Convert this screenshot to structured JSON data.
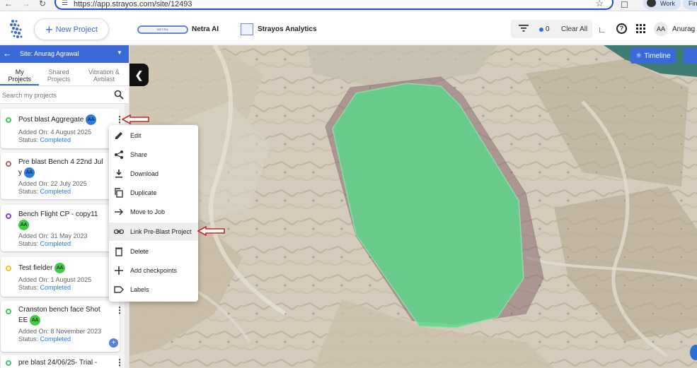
{
  "browser": {
    "url": "https://app.strayos.com/site/12493",
    "profile_label": "Work",
    "extra_tab": "Fini"
  },
  "header": {
    "new_project_label": "New Project",
    "netra_badge": "NETRA",
    "netra_label": "Netra AI",
    "analytics_label": "Strayos Analytics",
    "filter_count": "0",
    "clear_all_label": "Clear All",
    "avatar_initials": "AA",
    "user_name": "Anurag A"
  },
  "sidebar": {
    "site_label": "Site: Anurag Agrawal",
    "tabs": [
      {
        "line1": "My",
        "line2": "Projects"
      },
      {
        "line1": "Shared",
        "line2": "Projects"
      },
      {
        "line1": "Vibration &",
        "line2": "Airblast"
      }
    ],
    "search_placeholder": "Search my projects",
    "projects": [
      {
        "title": "Post blast Aggregate",
        "avatar": "AA",
        "avatar_color": "#2b7ee0",
        "dot_color": "#3cc96a",
        "added": "Added On: 4 August 2025",
        "status_prefix": "Status: ",
        "status": "Completed"
      },
      {
        "title": "Pre blast Bench 4 22nd Jul",
        "title2": "y",
        "avatar": "AA",
        "avatar_color": "#2b7ee0",
        "dot_color": "#9b6a6a",
        "added": "Added On: 22 July 2025",
        "status_prefix": "Status: ",
        "status": "Completed"
      },
      {
        "title": "Bench Flight CP - copy11",
        "avatar": "AA",
        "avatar_color": "#45c845",
        "dot_color": "#8a3ae0",
        "added": "Added On: 31 May 2023",
        "status_prefix": "Status: ",
        "status": "Completed"
      },
      {
        "title": "Test fielder",
        "avatar": "AA",
        "avatar_color": "#45c845",
        "dot_color": "#e8c622",
        "added": "Added On: 1 August 2025",
        "status_prefix": "Status: ",
        "status": "Completed"
      },
      {
        "title": "Cranston bench face Shot",
        "title2": "EE",
        "avatar": "AA",
        "avatar_color": "#45c845",
        "dot_color": "#3cc96a",
        "added": "Added On: 8 November 2023",
        "status_prefix": "Status: ",
        "status": "Completed"
      },
      {
        "title": "pre blast 24/06/25- Trial -",
        "dot_color": "#3cc96a"
      }
    ]
  },
  "map": {
    "timeline_label": "Timeline"
  },
  "context_menu": {
    "items": [
      {
        "label": "Edit",
        "icon": "pencil-icon"
      },
      {
        "label": "Share",
        "icon": "share-icon"
      },
      {
        "label": "Download",
        "icon": "download-icon"
      },
      {
        "label": "Duplicate",
        "icon": "duplicate-icon"
      },
      {
        "label": "Move to Job",
        "icon": "arrow-right-icon"
      },
      {
        "label": "Link Pre-Blast Project",
        "icon": "link-icon"
      },
      {
        "label": "Delete",
        "icon": "trash-icon"
      },
      {
        "label": "Add checkpoints",
        "icon": "plus-icon"
      },
      {
        "label": "Labels",
        "icon": "label-icon"
      }
    ]
  },
  "colors": {
    "accent": "#3b6ad8",
    "polygon_fill": "#5fd68c",
    "polygon_outline": "#a08a8f",
    "annotation_arrow": "#c62828"
  }
}
